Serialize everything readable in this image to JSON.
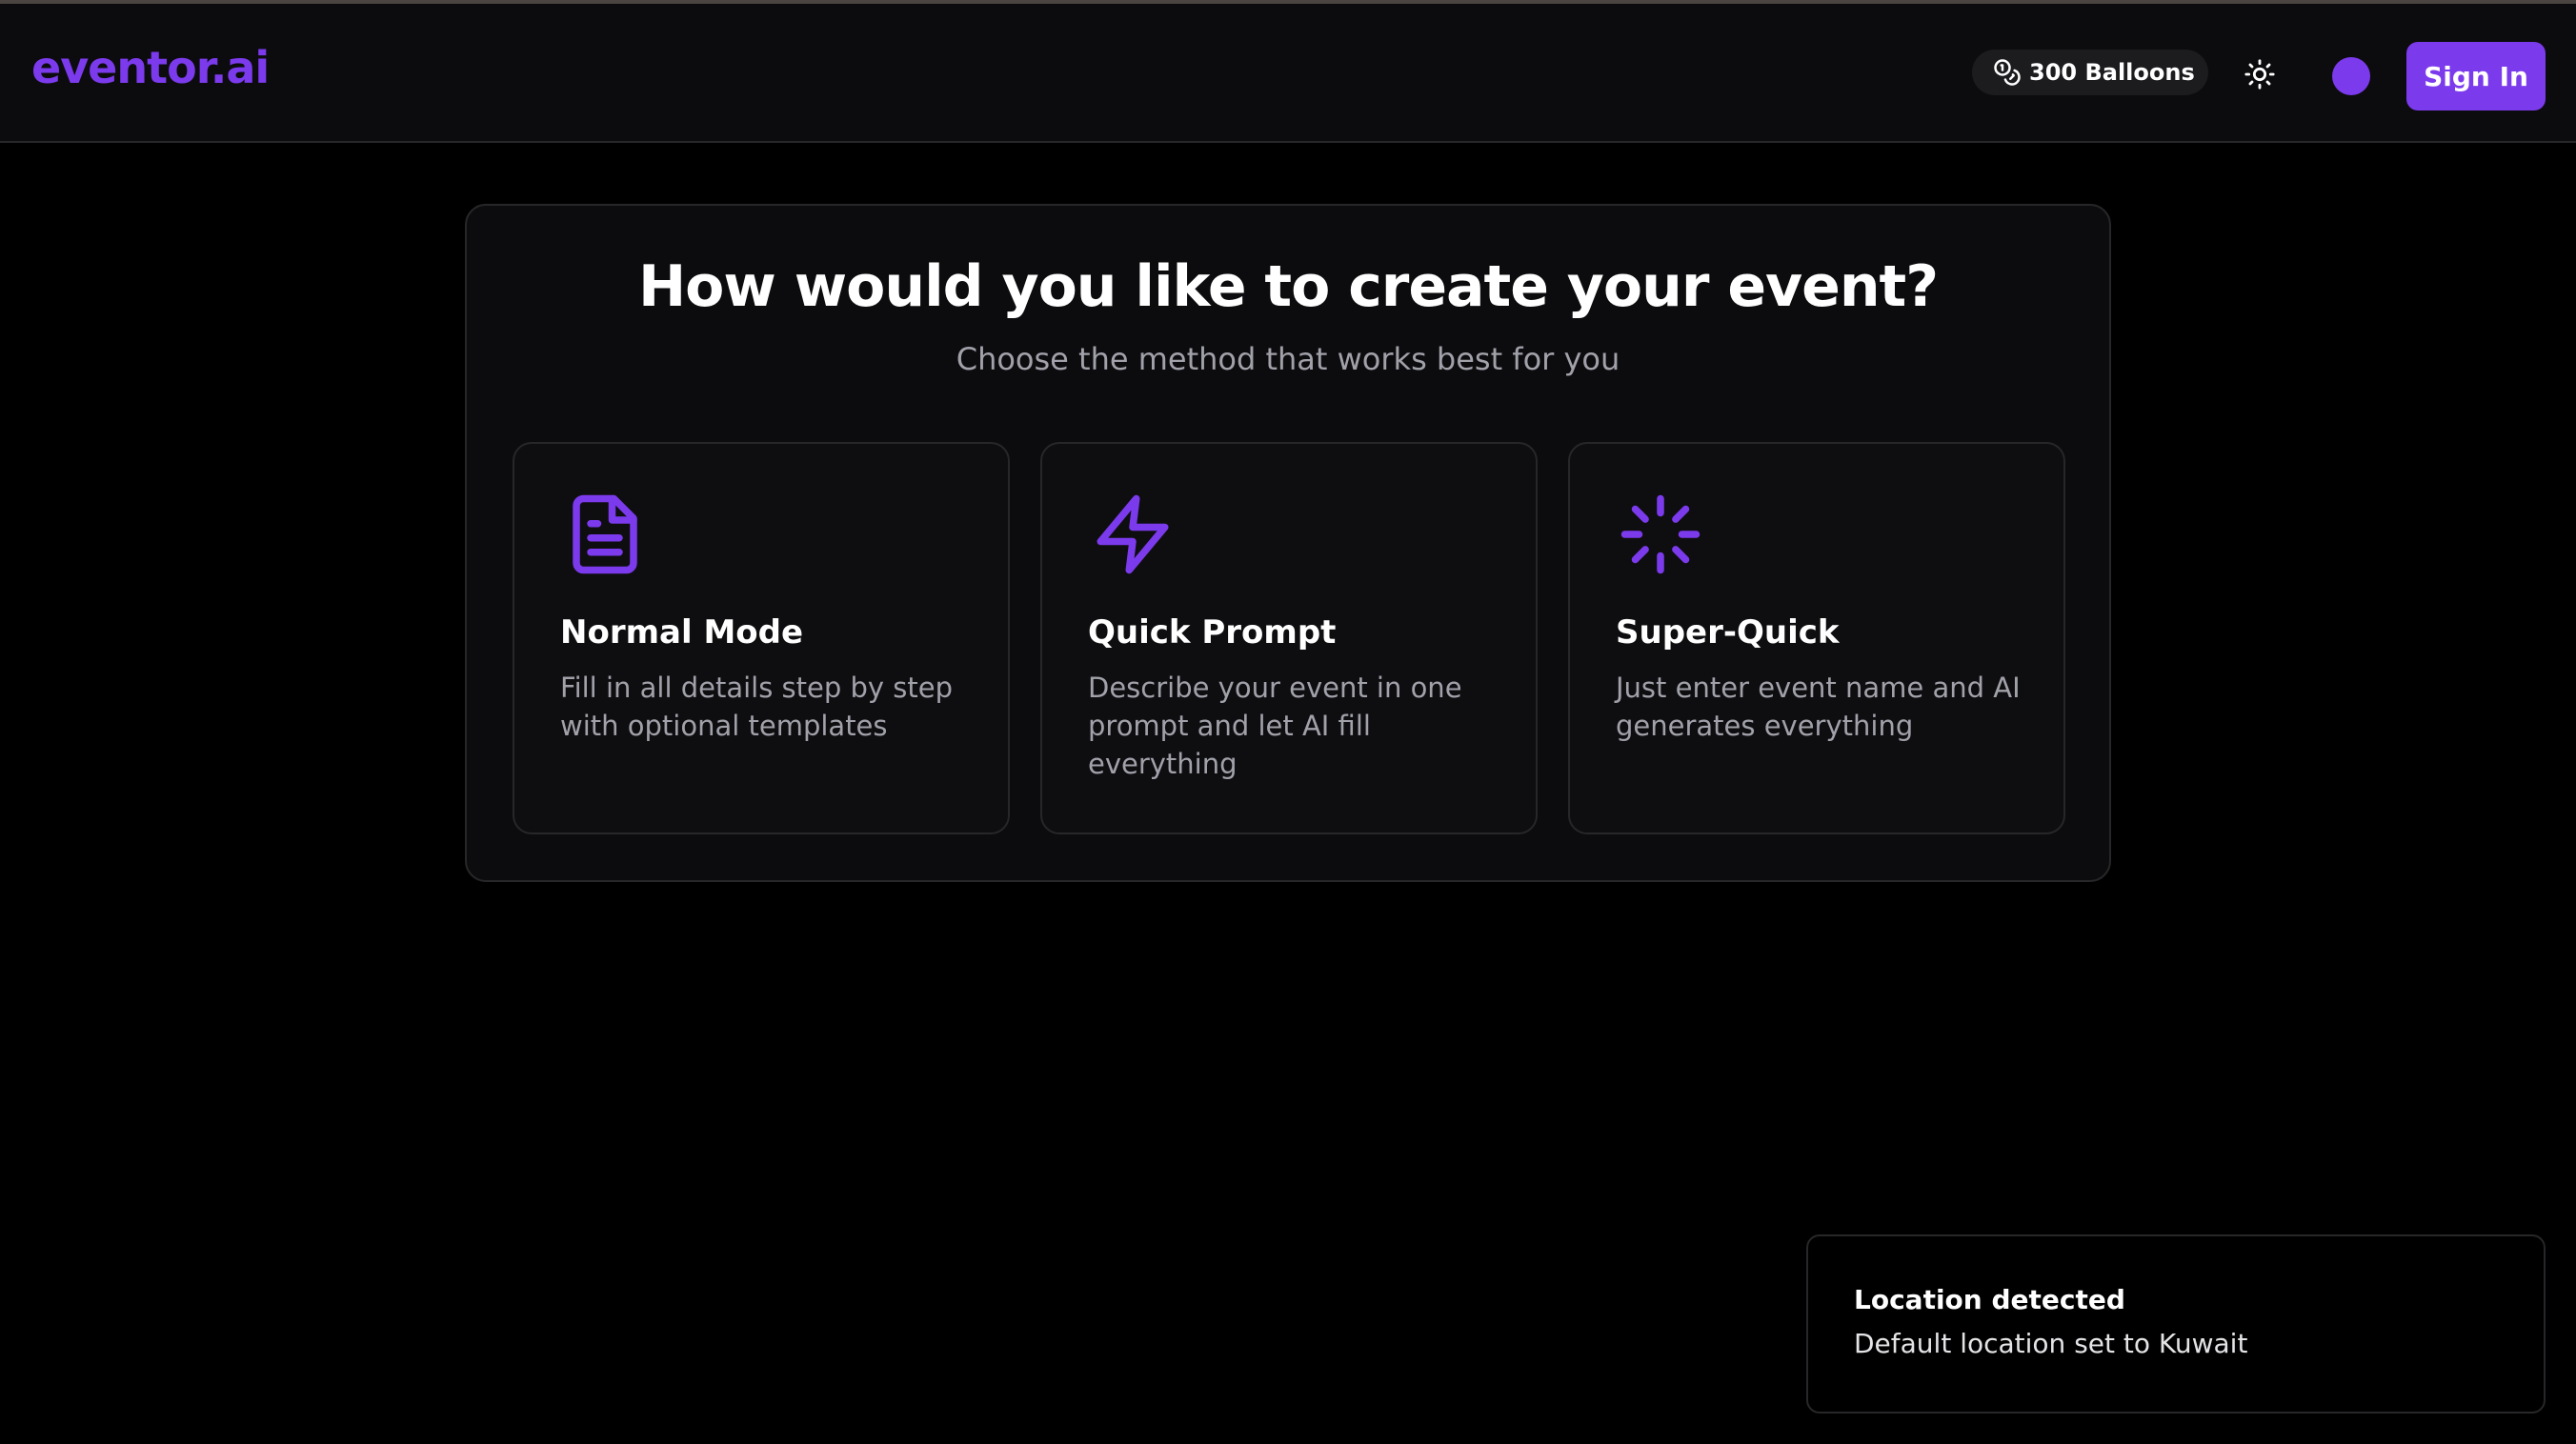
{
  "header": {
    "logo": "eventor.ai",
    "balloons_label": "300 Balloons",
    "balloons_icon": "coins-icon",
    "theme_icon": "sun-icon",
    "signin_label": "Sign In"
  },
  "main": {
    "title": "How would you like to create your event?",
    "subtitle": "Choose the method that works best for you",
    "cards": [
      {
        "icon": "file-text-icon",
        "title": "Normal Mode",
        "description": "Fill in all details step by step with optional templates"
      },
      {
        "icon": "zap-icon",
        "title": "Quick Prompt",
        "description": "Describe your event in one prompt and let AI fill everything"
      },
      {
        "icon": "loader-icon",
        "title": "Super-Quick",
        "description": "Just enter event name and AI generates everything"
      }
    ]
  },
  "toast": {
    "title": "Location detected",
    "description": "Default location set to Kuwait"
  },
  "colors": {
    "accent": "#7c3aed",
    "background": "#000000",
    "surface": "#0c0c0e",
    "border": "#27272a",
    "muted_text": "#a1a1aa"
  }
}
